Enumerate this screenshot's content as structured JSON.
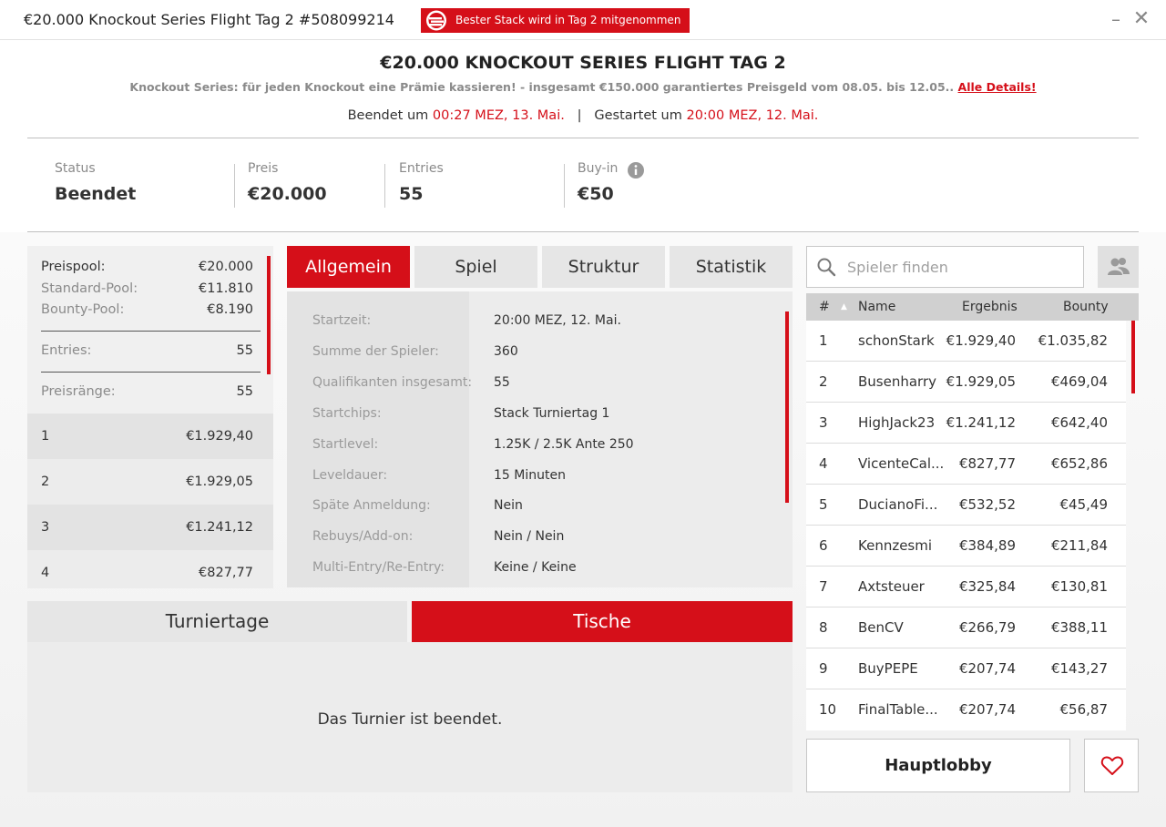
{
  "window": {
    "title": "€20.000 Knockout Series Flight Tag 2 #508099214",
    "badge": "Bester Stack wird in Tag 2 mitgenommen",
    "minimize": "–",
    "close": "✕"
  },
  "header": {
    "title": "€20.000 KNOCKOUT SERIES FLIGHT TAG 2",
    "subline": "Knockout Series: für jeden Knockout eine Prämie kassieren! - insgesamt €150.000 garantiertes Preisgeld vom 08.05. bis 12.05..",
    "details_link": "Alle Details!",
    "ended_label": "Beendet um",
    "ended_time": "00:27 MEZ, 13. Mai.",
    "separator": "|",
    "started_label": "Gestartet um",
    "started_time": "20:00 MEZ, 12. Mai."
  },
  "summary": {
    "status_label": "Status",
    "status_value": "Beendet",
    "price_label": "Preis",
    "price_value": "€20.000",
    "entries_label": "Entries",
    "entries_value": "55",
    "buyin_label": "Buy-in",
    "buyin_value": "€50"
  },
  "prizepool": {
    "pool_label": "Preispool:",
    "pool_value": "€20.000",
    "standard_label": "Standard-Pool:",
    "standard_value": "€11.810",
    "bounty_label": "Bounty-Pool:",
    "bounty_value": "€8.190",
    "entries_label": "Entries:",
    "entries_value": "55",
    "ranks_label": "Preisränge:",
    "ranks_value": "55",
    "places": [
      {
        "place": "1",
        "prize": "€1.929,40"
      },
      {
        "place": "2",
        "prize": "€1.929,05"
      },
      {
        "place": "3",
        "prize": "€1.241,12"
      },
      {
        "place": "4",
        "prize": "€827,77"
      }
    ]
  },
  "tabs": [
    "Allgemein",
    "Spiel",
    "Struktur",
    "Statistik"
  ],
  "info": [
    {
      "label": "Startzeit:",
      "value": "20:00 MEZ, 12. Mai."
    },
    {
      "label": "Summe der Spieler:",
      "value": "360"
    },
    {
      "label": "Qualifikanten insgesamt:",
      "value": "55"
    },
    {
      "label": "Startchips:",
      "value": "Stack Turniertag 1"
    },
    {
      "label": "Startlevel:",
      "value": "1.25K / 2.5K Ante 250"
    },
    {
      "label": "Leveldauer:",
      "value": "15 Minuten"
    },
    {
      "label": "Späte Anmeldung:",
      "value": "Nein"
    },
    {
      "label": "Rebuys/Add-on:",
      "value": "Nein / Nein"
    },
    {
      "label": "Multi-Entry/Re-Entry:",
      "value": "Keine / Keine"
    }
  ],
  "bottom_tabs": {
    "days": "Turniertage",
    "tables": "Tische"
  },
  "bottom_message": "Das Turnier ist beendet.",
  "search": {
    "placeholder": "Spieler finden"
  },
  "players": {
    "headers": {
      "no": "#",
      "name": "Name",
      "result": "Ergebnis",
      "bounty": "Bounty"
    },
    "rows": [
      {
        "no": "1",
        "name": "schonStark",
        "result": "€1.929,40",
        "bounty": "€1.035,82"
      },
      {
        "no": "2",
        "name": "Busenharry",
        "result": "€1.929,05",
        "bounty": "€469,04"
      },
      {
        "no": "3",
        "name": "HighJack23",
        "result": "€1.241,12",
        "bounty": "€642,40"
      },
      {
        "no": "4",
        "name": "VicenteCal...",
        "result": "€827,77",
        "bounty": "€652,86"
      },
      {
        "no": "5",
        "name": "DucianoFi...",
        "result": "€532,52",
        "bounty": "€45,49"
      },
      {
        "no": "6",
        "name": "Kennzesmi",
        "result": "€384,89",
        "bounty": "€211,84"
      },
      {
        "no": "7",
        "name": "Axtsteuer",
        "result": "€325,84",
        "bounty": "€130,81"
      },
      {
        "no": "8",
        "name": "BenCV",
        "result": "€266,79",
        "bounty": "€388,11"
      },
      {
        "no": "9",
        "name": "BuyPEPE",
        "result": "€207,74",
        "bounty": "€143,27"
      },
      {
        "no": "10",
        "name": "FinalTable...",
        "result": "€207,74",
        "bounty": "€56,87"
      }
    ]
  },
  "buttons": {
    "lobby": "Hauptlobby"
  },
  "colors": {
    "accent": "#d50f19",
    "panel": "#ececec"
  }
}
